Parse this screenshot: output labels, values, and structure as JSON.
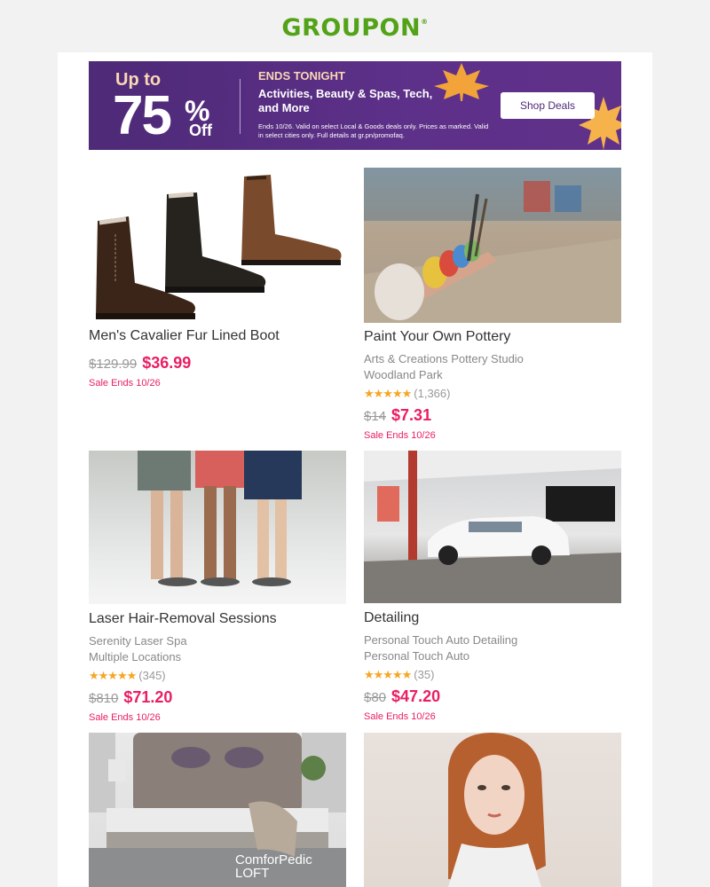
{
  "logo": {
    "text": "GROUPON",
    "mark": "®"
  },
  "colors": {
    "brand": "#53a318",
    "price": "#e91e63",
    "banner": "#5a2e85",
    "star": "#f5a623"
  },
  "banner": {
    "up_to": "Up to",
    "percent": "75",
    "pct_sign": "%",
    "off": "Off",
    "ends": "ENDS TONIGHT",
    "categories": "Activities, Beauty & Spas, Tech, and More",
    "fine_print": "Ends 10/26. Valid on select Local & Goods deals only. Prices as marked. Valid in select cities only. Full details at gr.pn/promofaq.",
    "button": "Shop Deals"
  },
  "deals": [
    {
      "title": "Men's Cavalier Fur Lined Boot",
      "was": "$129.99",
      "now": "$36.99",
      "sale": "Sale Ends 10/26"
    },
    {
      "title": "Paint Your Own Pottery",
      "merchant": "Arts & Creations Pottery Studio",
      "location": "Woodland Park",
      "rating": 4.5,
      "stars": "★★★★★",
      "reviews": "(1,366)",
      "was": "$14",
      "now": "$7.31",
      "sale": "Sale Ends 10/26"
    },
    {
      "title": "Laser Hair-Removal Sessions",
      "merchant": "Serenity Laser Spa",
      "location": "Multiple Locations",
      "rating": 4.5,
      "stars": "★★★★★",
      "reviews": "(345)",
      "was": "$810",
      "now": "$71.20",
      "sale": "Sale Ends 10/26"
    },
    {
      "title": "Detailing",
      "merchant": "Personal Touch Auto Detailing",
      "location": "Personal Touch Auto",
      "rating": 4.5,
      "stars": "★★★★★",
      "reviews": "(35)",
      "was": "$80",
      "now": "$47.20",
      "sale": "Sale Ends 10/26"
    },
    {
      "brand_logo": "ComforPedic LOFT"
    },
    {}
  ]
}
